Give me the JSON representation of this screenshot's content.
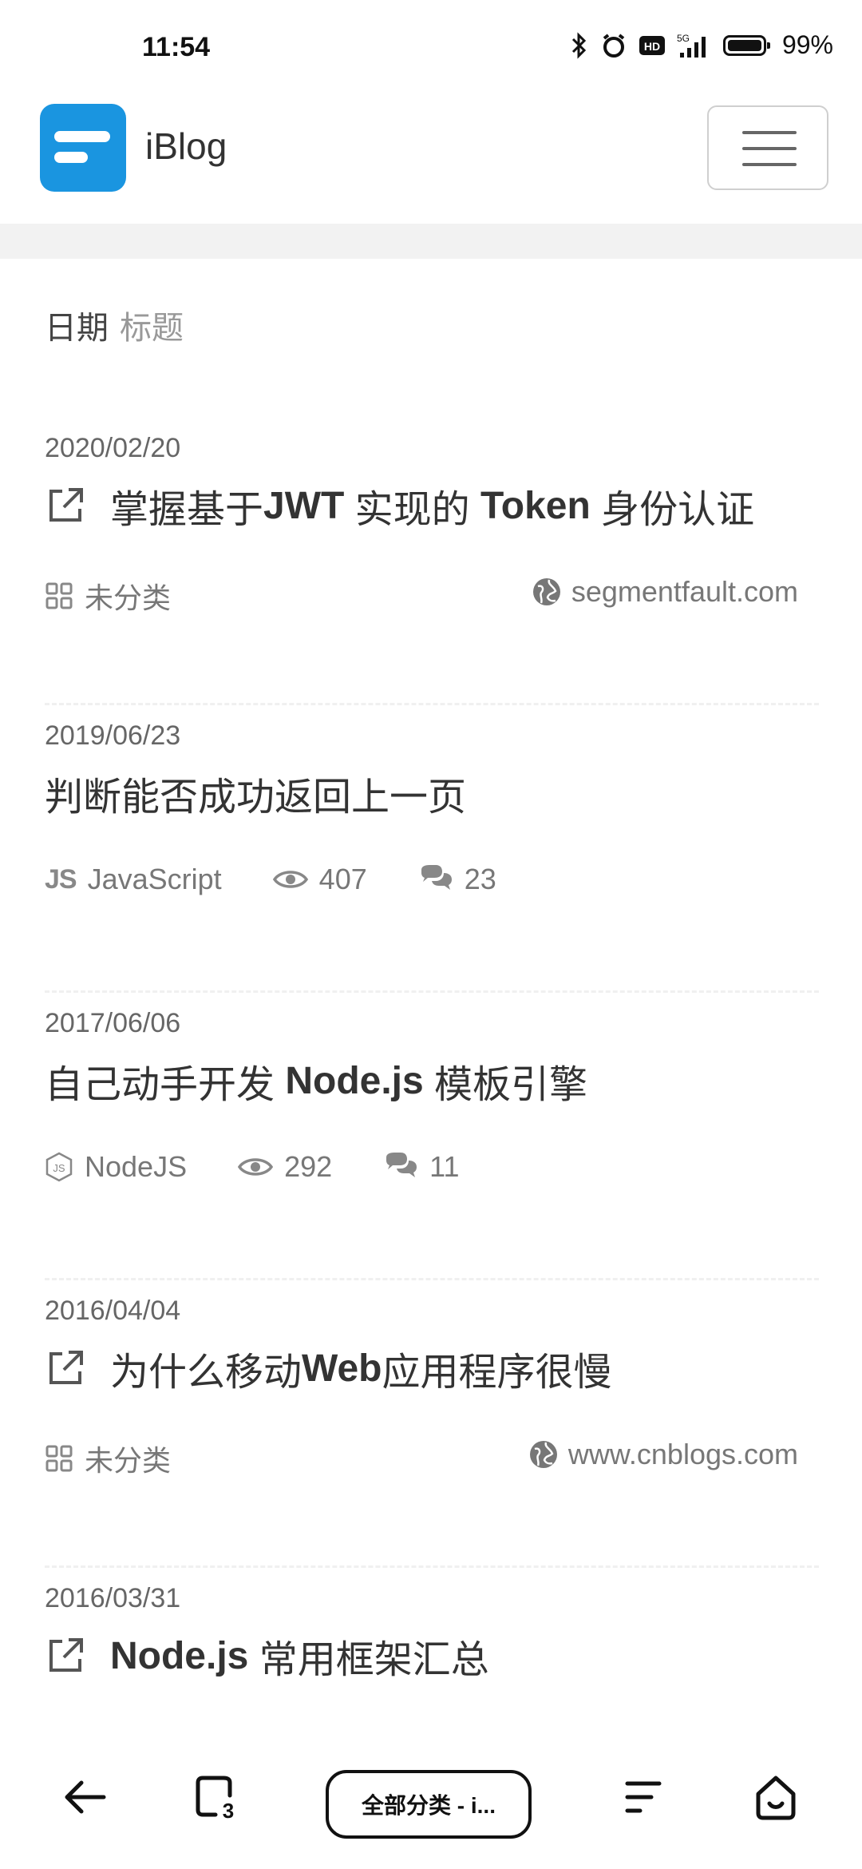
{
  "status_bar": {
    "time": "11:54",
    "signal_label": "5G",
    "hd_label": "HD",
    "battery": "99%"
  },
  "header": {
    "brand": "iBlog"
  },
  "sort": {
    "active": "日期",
    "inactive": "标题"
  },
  "posts": [
    {
      "date": "2020/02/20",
      "title_pre": "掌握基于 ",
      "title_bold1": "JWT",
      "title_mid": " 实现的 ",
      "title_bold2": "Token",
      "title_post": " 身份认证",
      "category": "未分类",
      "source": "segmentfault.com"
    },
    {
      "date": "2019/06/23",
      "title": "判断能否成功返回上一页",
      "category": "JavaScript",
      "category_glyph": "JS",
      "views": "407",
      "comments": "23"
    },
    {
      "date": "2017/06/06",
      "title_pre": "自己动手开发 ",
      "title_bold": "Node.js",
      "title_post": " 模板引擎",
      "category": "NodeJS",
      "views": "292",
      "comments": "11"
    },
    {
      "date": "2016/04/04",
      "title_pre": "为什么移动",
      "title_bold": "Web",
      "title_post": "应用程序很慢",
      "category": "未分类",
      "source": "www.cnblogs.com"
    },
    {
      "date": "2016/03/31",
      "title_bold": "Node.js",
      "title_post": " 常用框架汇总"
    }
  ],
  "bottom_bar": {
    "tab_label": "全部分类 - i...",
    "tab_count": "3"
  },
  "colors": {
    "brand_blue": "#1a95e0",
    "text": "#333333",
    "muted": "#777777"
  }
}
